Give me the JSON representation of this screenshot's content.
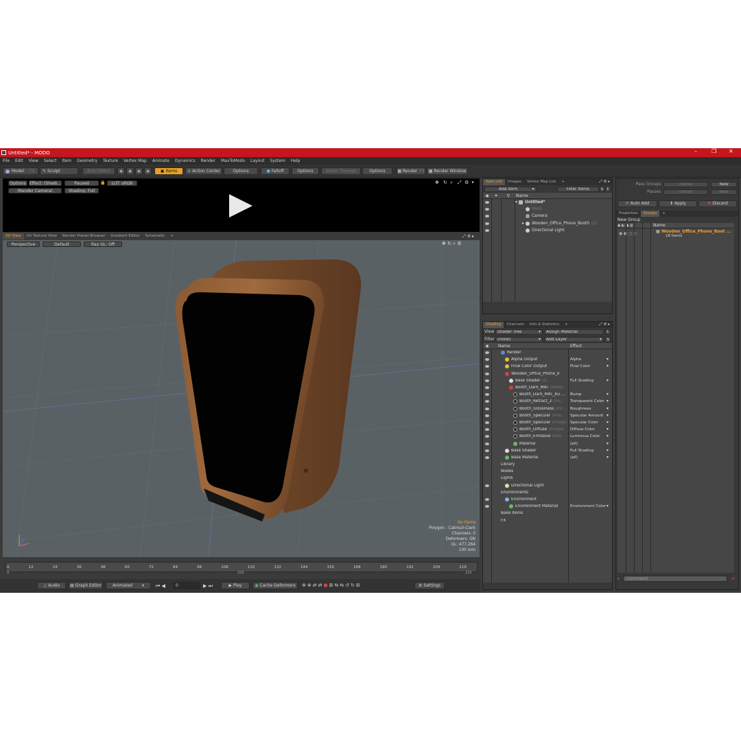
{
  "window": {
    "title": "Untitled* - MODO",
    "minimize": "–",
    "maximize": "❐",
    "close": "✕"
  },
  "menu": [
    "File",
    "Edit",
    "View",
    "Select",
    "Item",
    "Geometry",
    "Texture",
    "Vertex Map",
    "Animate",
    "Dynamics",
    "Render",
    "MaxToModo",
    "Layout",
    "System",
    "Help"
  ],
  "toolbar": {
    "model": "Model",
    "model_key": "F2",
    "sculpt": "Sculpt",
    "auto_select": "Auto Select",
    "items": "Items",
    "action_center": "Action Center",
    "options1": "Options",
    "falloff": "Falloff",
    "options2": "Options",
    "select_through": "Select Through",
    "options3": "Options",
    "render": "Render",
    "render_key": "F9",
    "render_window": "Render Window"
  },
  "preview": {
    "options": "Options",
    "effect": "Effect: (Shadi...",
    "paused": "Paused",
    "lut": "LUT: sRGB",
    "camera": "(Render Camera)",
    "shading": "Shading: Full"
  },
  "viewtabs": [
    "3D View",
    "UV Texture View",
    "Render Preset Browser",
    "Gradient Editor",
    "Schematic",
    "+"
  ],
  "viewport": {
    "perspective": "Perspective",
    "default": "Default",
    "raygl": "Ray GL: Off",
    "no_items": "No Items",
    "polygon": "Polygon : Catmull-Clark",
    "channels": "Channels: 0",
    "deformers": "Deformers: ON",
    "gl": "GL: 477,264",
    "scale": "100 mm"
  },
  "timeline": {
    "ticks": [
      "0",
      "12",
      "24",
      "36",
      "48",
      "60",
      "72",
      "84",
      "96",
      "108",
      "120",
      "132",
      "144",
      "156",
      "168",
      "180",
      "192",
      "204",
      "216"
    ],
    "start": "0",
    "mid": "225",
    "end": "225"
  },
  "transport": {
    "audio": "Audio",
    "graph_editor": "Graph Editor",
    "animated": "Animated",
    "frame": "0",
    "play": "Play",
    "cache": "Cache Deformers",
    "settings": "Settings"
  },
  "itemlist": {
    "tabs": [
      "Item List",
      "Images",
      "Vertex Map List",
      "+"
    ],
    "add_item": "Add Item",
    "filter_items": "Filter Items",
    "s": "S",
    "f": "F",
    "name_header": "Name",
    "rows": [
      {
        "label": "Untitled*",
        "indent": 0
      },
      {
        "label": "Mesh",
        "indent": 1,
        "dim": true
      },
      {
        "label": "Camera",
        "indent": 1
      },
      {
        "label": "Wooden_Office_Phone_Booth",
        "suffix": "(2)",
        "indent": 1
      },
      {
        "label": "Directional Light",
        "indent": 1
      }
    ]
  },
  "shading": {
    "tabs": [
      "Shading",
      "Channels",
      "Info & Statistics",
      "+"
    ],
    "view_label": "View",
    "view_value": "Shader Tree",
    "assign": "Assign Material",
    "f": "F",
    "filter_label": "Filter",
    "filter_value": "(none)",
    "add_layer": "Add Layer",
    "s": "S",
    "name_header": "Name",
    "effect_header": "Effect",
    "rows": [
      {
        "label": "Render",
        "effect": "",
        "indent": 0,
        "c": "#5a8ad8"
      },
      {
        "label": "Alpha Output",
        "effect": "Alpha",
        "indent": 1,
        "c": "#e0c040"
      },
      {
        "label": "Final Color Output",
        "effect": "Final Color",
        "indent": 1,
        "c": "#e0c040"
      },
      {
        "label": "Wooden_Office_Phone_Bo...",
        "effect": "",
        "indent": 1,
        "c": "#d84040"
      },
      {
        "label": "Base Shader",
        "suffix": "(2)",
        "effect": "Full Shading",
        "indent": 2,
        "c": "#dddddd"
      },
      {
        "label": "Booth_Dark_MAT",
        "suffix": "(Mater...",
        "effect": "",
        "indent": 2,
        "c": "#d84040"
      },
      {
        "label": "Booth_Dark_MAT_bu ...",
        "effect": "Bump",
        "indent": 3,
        "c": "#222"
      },
      {
        "label": "Booth_Refract_2",
        "suffix": "(Im...",
        "effect": "Transparent Color",
        "indent": 3,
        "c": "#222"
      },
      {
        "label": "Booth_Glossiness",
        "suffix": "(Im...",
        "effect": "Roughness",
        "indent": 3,
        "c": "#222"
      },
      {
        "label": "Booth_Specular",
        "suffix": "(Ima...",
        "effect": "Specular Amount",
        "indent": 3,
        "c": "#222"
      },
      {
        "label": "Booth_Specular",
        "suffix": "(Image)",
        "effect": "Specular Color",
        "indent": 3,
        "c": "#222"
      },
      {
        "label": "Booth_Diffuse",
        "suffix": "(Image)",
        "effect": "Diffuse Color",
        "indent": 3,
        "c": "#222"
      },
      {
        "label": "Booth_Emissive",
        "suffix": "(Ima...",
        "effect": "Luminous Color",
        "indent": 3,
        "c": "#222"
      },
      {
        "label": "Material",
        "effect": "(all)",
        "indent": 3,
        "c": "#60c060"
      },
      {
        "label": "Base Shader",
        "effect": "Full Shading",
        "indent": 1,
        "c": "#dddddd"
      },
      {
        "label": "Base Material",
        "effect": "(all)",
        "indent": 1,
        "c": "#60c060"
      },
      {
        "label": "Library",
        "effect": "",
        "indent": 0,
        "c": ""
      },
      {
        "label": "Nodes",
        "effect": "",
        "indent": 0,
        "c": ""
      },
      {
        "label": "Lights",
        "effect": "",
        "indent": 0,
        "c": ""
      },
      {
        "label": "Directional Light",
        "effect": "",
        "indent": 1,
        "c": "#e0e0a0"
      },
      {
        "label": "Environments",
        "effect": "",
        "indent": 0,
        "c": ""
      },
      {
        "label": "Environment",
        "effect": "",
        "indent": 1,
        "c": "#8ab0e0"
      },
      {
        "label": "Environment Material",
        "effect": "Environment Color",
        "indent": 2,
        "c": "#60c060"
      },
      {
        "label": "Bake Items",
        "effect": "",
        "indent": 0,
        "c": ""
      },
      {
        "label": "FX",
        "effect": "",
        "indent": 0,
        "c": ""
      }
    ]
  },
  "groups": {
    "pass_groups": "Pass Groups",
    "pass_value": "(none)",
    "new": "New",
    "passes": "Passes",
    "passes_value": "(none)",
    "new2": "New",
    "auto_add": "Auto Add",
    "apply": "Apply",
    "discard": "Discard",
    "tabs": [
      "Properties",
      "Groups",
      "+"
    ],
    "new_group": "New Group",
    "name_header": "Name",
    "group_name": "Wooden_Office_Phone_Boot ...",
    "group_items": "18 Items",
    "command": "Command"
  },
  "colors": {
    "accent": "#e8a024",
    "titlebar": "#c4161c"
  }
}
